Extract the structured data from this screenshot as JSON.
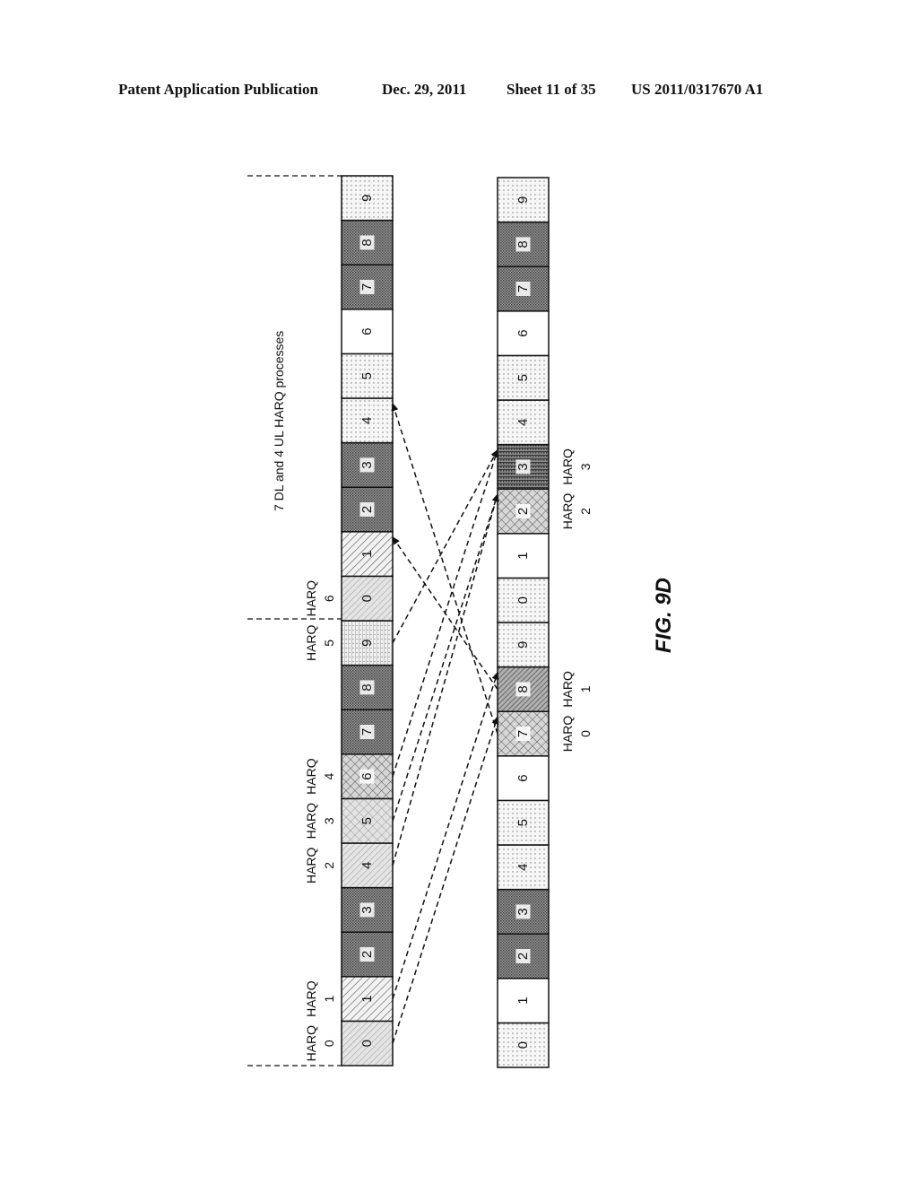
{
  "header": {
    "publication": "Patent Application Publication",
    "date": "Dec. 29, 2011",
    "sheet": "Sheet 11 of 35",
    "number": "US 2011/0317670 A1"
  },
  "figure": {
    "title": "7 DL and 4 UL HARQ processes",
    "label": "FIG. 9D",
    "left_bar": {
      "cells": [
        {
          "num": "0",
          "pattern": "hatch-light"
        },
        {
          "num": "1",
          "pattern": "hatch"
        },
        {
          "num": "2",
          "pattern": "dense"
        },
        {
          "num": "3",
          "pattern": "dense"
        },
        {
          "num": "4",
          "pattern": "hatch-light"
        },
        {
          "num": "5",
          "pattern": "cross-light"
        },
        {
          "num": "6",
          "pattern": "cross"
        },
        {
          "num": "7",
          "pattern": "dense"
        },
        {
          "num": "8",
          "pattern": "dense"
        },
        {
          "num": "9",
          "pattern": "lines-dots"
        },
        {
          "num": "0",
          "pattern": "hatch-light"
        },
        {
          "num": "1",
          "pattern": "hatch"
        },
        {
          "num": "2",
          "pattern": "dense"
        },
        {
          "num": "3",
          "pattern": "dense"
        },
        {
          "num": "4",
          "pattern": "dots"
        },
        {
          "num": "5",
          "pattern": "dots"
        },
        {
          "num": "6",
          "pattern": "white"
        },
        {
          "num": "7",
          "pattern": "dense"
        },
        {
          "num": "8",
          "pattern": "dense"
        },
        {
          "num": "9",
          "pattern": "dots"
        }
      ],
      "harq_labels": [
        {
          "text": "HARQ",
          "num": "0",
          "cell": 0
        },
        {
          "text": "HARQ",
          "num": "1",
          "cell": 1
        },
        {
          "text": "HARQ",
          "num": "2",
          "cell": 4
        },
        {
          "text": "HARQ",
          "num": "3",
          "cell": 5
        },
        {
          "text": "HARQ",
          "num": "4",
          "cell": 6
        },
        {
          "text": "HARQ",
          "num": "5",
          "cell": 9
        },
        {
          "text": "HARQ",
          "num": "6",
          "cell": 10
        }
      ]
    },
    "right_bar": {
      "cells": [
        {
          "num": "0",
          "pattern": "dots"
        },
        {
          "num": "1",
          "pattern": "white"
        },
        {
          "num": "2",
          "pattern": "dense"
        },
        {
          "num": "3",
          "pattern": "dense"
        },
        {
          "num": "4",
          "pattern": "dots"
        },
        {
          "num": "5",
          "pattern": "dots"
        },
        {
          "num": "6",
          "pattern": "white"
        },
        {
          "num": "7",
          "pattern": "cross"
        },
        {
          "num": "8",
          "pattern": "hatch-dense"
        },
        {
          "num": "9",
          "pattern": "dots"
        },
        {
          "num": "0",
          "pattern": "dots"
        },
        {
          "num": "1",
          "pattern": "white"
        },
        {
          "num": "2",
          "pattern": "cross"
        },
        {
          "num": "3",
          "pattern": "dense-lines"
        },
        {
          "num": "4",
          "pattern": "dots"
        },
        {
          "num": "5",
          "pattern": "dots"
        },
        {
          "num": "6",
          "pattern": "white"
        },
        {
          "num": "7",
          "pattern": "dense"
        },
        {
          "num": "8",
          "pattern": "dense"
        },
        {
          "num": "9",
          "pattern": "dots"
        }
      ],
      "harq_labels": [
        {
          "text": "HARQ",
          "num": "0",
          "cell": 7
        },
        {
          "text": "HARQ",
          "num": "1",
          "cell": 8
        },
        {
          "text": "HARQ",
          "num": "2",
          "cell": 12
        },
        {
          "text": "HARQ",
          "num": "3",
          "cell": 13
        }
      ]
    },
    "arrows": [
      {
        "from": "left",
        "from_cell": 0,
        "to_cell": 7,
        "direction": "to-right"
      },
      {
        "from": "left",
        "from_cell": 1,
        "to_cell": 8,
        "direction": "to-right"
      },
      {
        "from": "left",
        "from_cell": 4,
        "to_cell": 12,
        "direction": "to-right"
      },
      {
        "from": "left",
        "from_cell": 5,
        "to_cell": 12,
        "direction": "to-right"
      },
      {
        "from": "left",
        "from_cell": 6,
        "to_cell": 13,
        "direction": "to-right"
      },
      {
        "from": "left",
        "from_cell": 9,
        "to_cell": 13,
        "direction": "to-right"
      },
      {
        "from": "right",
        "from_cell": 7,
        "to_cell": 14,
        "direction": "to-left"
      },
      {
        "from": "right",
        "from_cell": 8,
        "to_cell": 11,
        "direction": "to-left"
      }
    ]
  }
}
